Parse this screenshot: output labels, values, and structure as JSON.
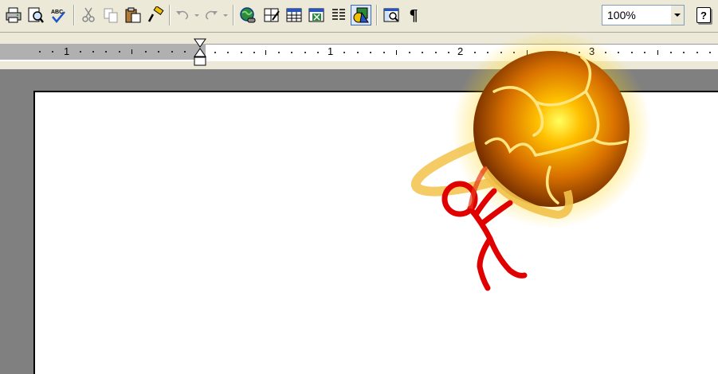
{
  "toolbar": {
    "buttons": [
      {
        "name": "print-icon"
      },
      {
        "name": "print-preview-icon"
      },
      {
        "name": "spelling-icon"
      },
      {
        "name": "cut-icon"
      },
      {
        "name": "copy-icon"
      },
      {
        "name": "paste-icon"
      },
      {
        "name": "format-painter-icon"
      },
      {
        "name": "undo-icon"
      },
      {
        "name": "redo-icon"
      },
      {
        "name": "hyperlink-icon"
      },
      {
        "name": "tables-borders-icon"
      },
      {
        "name": "insert-table-icon"
      },
      {
        "name": "insert-excel-icon"
      },
      {
        "name": "columns-icon"
      },
      {
        "name": "drawing-icon"
      },
      {
        "name": "document-map-icon"
      },
      {
        "name": "show-formatting-icon"
      },
      {
        "name": "help-icon"
      }
    ],
    "zoom": "100%",
    "show_formatting_glyph": "¶",
    "help_glyph": "?"
  },
  "ruler": {
    "labels": [
      "1",
      "1",
      "2",
      "3"
    ]
  },
  "colors": {
    "chrome": "#ECE9D8",
    "workspace": "#808080",
    "stick_figure": "#E00000",
    "orb": "#E08A00"
  }
}
